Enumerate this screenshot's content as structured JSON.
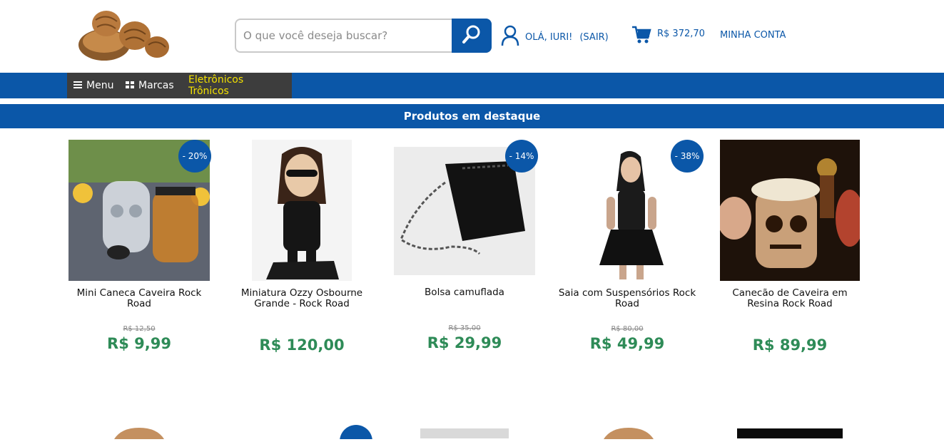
{
  "search": {
    "placeholder": "O que você deseja buscar?"
  },
  "user": {
    "greeting": "OLÁ, IURI!",
    "logout": "(SAIR)"
  },
  "cart": {
    "total": "R$ 372,70"
  },
  "account": {
    "label": "MINHA CONTA"
  },
  "nav": [
    {
      "label": "Menu",
      "icon": "hamburger-icon"
    },
    {
      "label": "Marcas",
      "icon": "grid-icon"
    },
    {
      "label": "Eletrônicos Trônicos"
    }
  ],
  "section": {
    "title": "Produtos em destaque"
  },
  "products": [
    {
      "name": "Mini Caneca Caveira Rock Road",
      "badge": "- 20%",
      "old_price": "R$ 12,50",
      "price": "R$ 9,99"
    },
    {
      "name": "Miniatura Ozzy Osbourne Grande - Rock Road",
      "badge": "",
      "old_price": "",
      "price": "R$ 120,00"
    },
    {
      "name": "Bolsa camuflada",
      "badge": "- 14%",
      "old_price": "R$ 35,00",
      "price": "R$ 29,99"
    },
    {
      "name": "Saia com Suspensórios Rock Road",
      "badge": "- 38%",
      "old_price": "R$ 80,00",
      "price": "R$ 49,99"
    },
    {
      "name": "Canecão de Caveira em Resina Rock Road",
      "badge": "",
      "old_price": "",
      "price": "R$ 89,99"
    }
  ],
  "colors": {
    "primary": "#0b57a8",
    "price": "#2e8b57",
    "nav_dark": "#3d3d3d",
    "highlight": "#f3e100"
  }
}
